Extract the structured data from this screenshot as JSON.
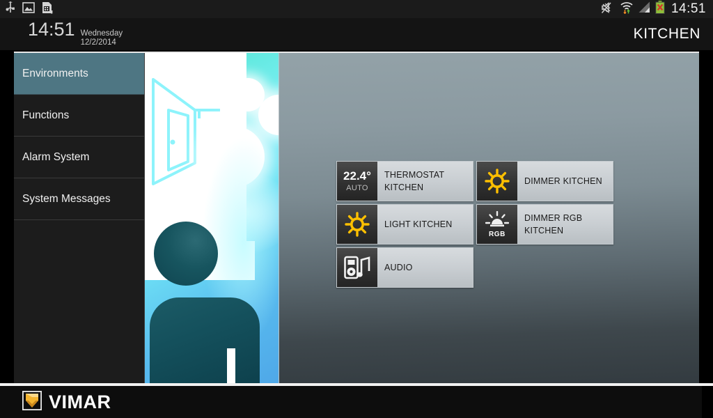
{
  "statusbar": {
    "clock": "14:51",
    "left_icons": [
      "usb-icon",
      "screenshot-image-icon",
      "sim-card-icon"
    ],
    "right_icons": [
      "mute-speaker-icon",
      "wifi-data-transfer-icon",
      "cellular-signal-icon",
      "battery-error-icon"
    ]
  },
  "header": {
    "time": "14:51",
    "weekday": "Wednesday",
    "date": "12/2/2014",
    "room": "KITCHEN"
  },
  "sidebar": {
    "items": [
      {
        "label": "Environments",
        "selected": true
      },
      {
        "label": "Functions",
        "selected": false
      },
      {
        "label": "Alarm System",
        "selected": false
      },
      {
        "label": "System Messages",
        "selected": false
      }
    ]
  },
  "illustration": {
    "name": "environment-room-illustration"
  },
  "tiles": [
    {
      "id": "thermostat-kitchen",
      "icon": "thermostat-icon",
      "value": "22.4°",
      "mode": "AUTO",
      "label": "THERMOSTAT KITCHEN"
    },
    {
      "id": "dimmer-kitchen",
      "icon": "light-bulb-on-icon",
      "label": "DIMMER KITCHEN"
    },
    {
      "id": "light-kitchen",
      "icon": "light-bulb-on-icon",
      "label": "LIGHT KITCHEN"
    },
    {
      "id": "dimmer-rgb-kitchen",
      "icon": "rgb-lamp-icon",
      "tag": "RGB",
      "label": "DIMMER RGB KITCHEN"
    },
    {
      "id": "audio",
      "icon": "audio-player-icon",
      "label": "AUDIO"
    }
  ],
  "footer": {
    "brand": "VIMAR",
    "logo_icon": "vimar-shield-logo"
  },
  "colors": {
    "accent_selected": "#4e7683",
    "tile_icon_on": "#ffc000",
    "brand_gold": "#f0a92a",
    "panel_light": "#93a2a8",
    "panel_dark": "#333b40"
  }
}
